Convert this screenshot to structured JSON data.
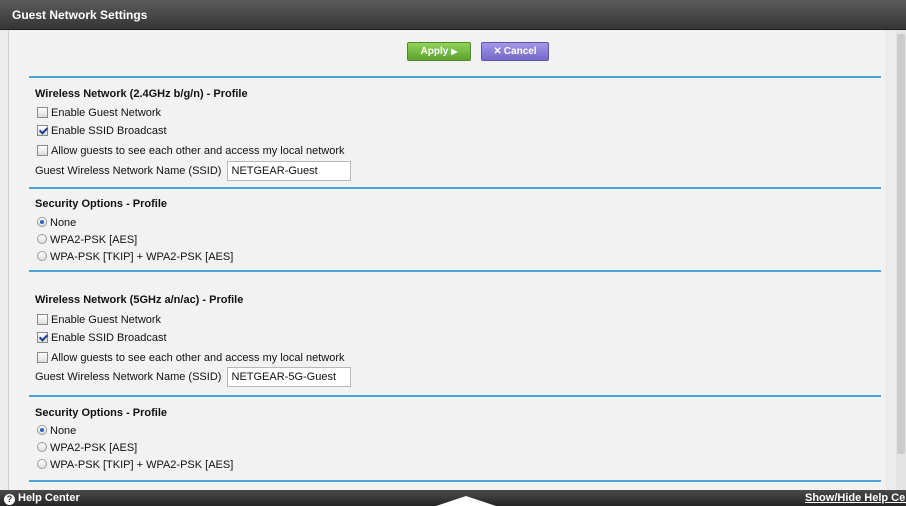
{
  "window": {
    "title": "Guest Network Settings"
  },
  "toolbar": {
    "apply_label": "Apply",
    "cancel_label": "Cancel"
  },
  "wifi24": {
    "title": "Wireless Network (2.4GHz b/g/n) - Profile",
    "enable_guest": {
      "label": "Enable Guest Network",
      "checked": false
    },
    "ssid_broadcast": {
      "label": "Enable SSID Broadcast",
      "checked": true
    },
    "allow_guests": {
      "label": "Allow guests to see each other and access my local network",
      "checked": false
    },
    "ssid_label": "Guest Wireless Network Name (SSID)",
    "ssid_value": "NETGEAR-Guest"
  },
  "security24": {
    "title": "Security Options - Profile",
    "options": [
      "None",
      "WPA2-PSK [AES]",
      "WPA-PSK [TKIP] + WPA2-PSK [AES]"
    ],
    "selected": "None"
  },
  "wifi5": {
    "title": "Wireless Network (5GHz a/n/ac) - Profile",
    "enable_guest": {
      "label": "Enable Guest Network",
      "checked": false
    },
    "ssid_broadcast": {
      "label": "Enable SSID Broadcast",
      "checked": true
    },
    "allow_guests": {
      "label": "Allow guests to see each other and access my local network",
      "checked": false
    },
    "ssid_label": "Guest Wireless Network Name (SSID)",
    "ssid_value": "NETGEAR-5G-Guest"
  },
  "security5": {
    "title": "Security Options - Profile",
    "options": [
      "None",
      "WPA2-PSK [AES]",
      "WPA-PSK [TKIP] + WPA2-PSK [AES]"
    ],
    "selected": "None"
  },
  "footer": {
    "help_label": "Help Center",
    "show_hide_label": "Show/Hide Help Cente"
  },
  "colors": {
    "accent_line": "#4aa3d6",
    "apply_green": "#6ab83a",
    "cancel_purple": "#8074d6"
  }
}
